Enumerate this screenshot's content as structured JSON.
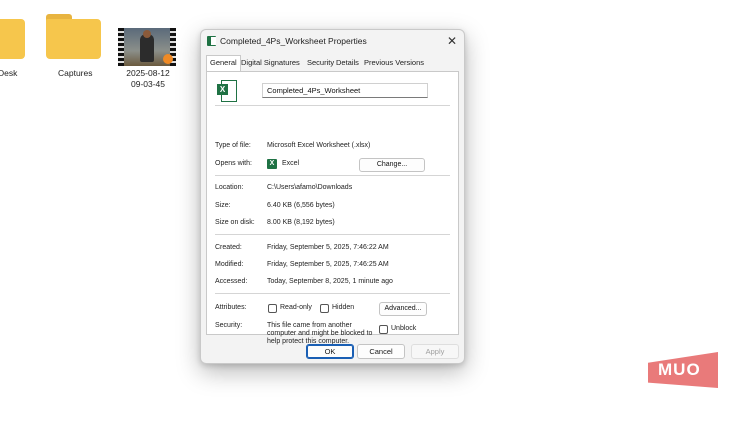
{
  "desktop": {
    "items": [
      {
        "label": "Desk"
      },
      {
        "label": "Captures"
      },
      {
        "label": "2025-08-12",
        "label2": "09-03-45"
      }
    ]
  },
  "dialog": {
    "title": "Completed_4Ps_Worksheet Properties",
    "close_glyph": "✕",
    "tabs": [
      "General",
      "Digital Signatures",
      "Security",
      "Details",
      "Previous Versions"
    ],
    "active_tab": "General",
    "file_name": "Completed_4Ps_Worksheet",
    "type_label": "Type of file:",
    "type_value": "Microsoft Excel Worksheet (.xlsx)",
    "opens_label": "Opens with:",
    "opens_value": "Excel",
    "excel_glyph": "X",
    "change_button": "Change...",
    "location_label": "Location:",
    "location_value": "C:\\Users\\afamo\\Downloads",
    "size_label": "Size:",
    "size_value": "6.40 KB (6,556 bytes)",
    "size_on_disk_label": "Size on disk:",
    "size_on_disk_value": "8.00 KB (8,192 bytes)",
    "created_label": "Created:",
    "created_value": "Friday, September 5, 2025, 7:46:22 AM",
    "modified_label": "Modified:",
    "modified_value": "Friday, September 5, 2025, 7:46:25 AM",
    "accessed_label": "Accessed:",
    "accessed_value": "Today, September 8, 2025, 1 minute ago",
    "attributes_label": "Attributes:",
    "readonly_label": "Read-only",
    "hidden_label": "Hidden",
    "advanced_button": "Advanced...",
    "security_label": "Security:",
    "security_line1": "This file came from another",
    "security_line2": "computer and might be blocked to",
    "security_line3": "help protect this computer.",
    "unblock_label": "Unblock",
    "ok_button": "OK",
    "cancel_button": "Cancel",
    "apply_button": "Apply"
  },
  "watermark": {
    "text": "MUO"
  },
  "colors": {
    "excel_green": "#1f7244",
    "folder_yellow": "#f6c64c",
    "watermark": "#e97a7a",
    "primary_border": "#1a5fb4"
  }
}
